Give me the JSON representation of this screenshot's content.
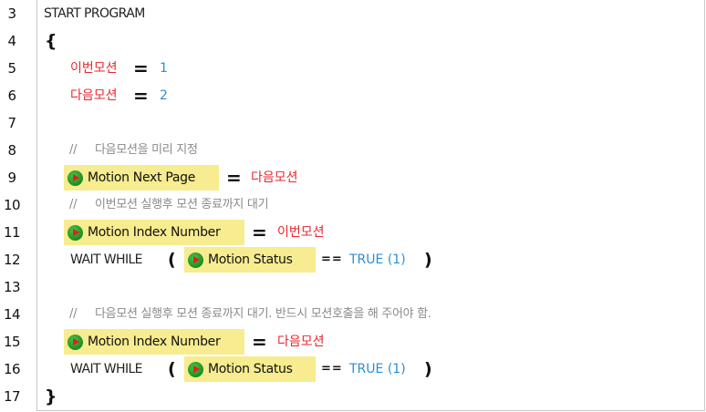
{
  "lines": {
    "l3": {
      "num": "3",
      "text": "START PROGRAM"
    },
    "l4": {
      "num": "4",
      "text": "{"
    },
    "l5": {
      "num": "5",
      "var": "이번모션",
      "eq": "=",
      "val": "1"
    },
    "l6": {
      "num": "6",
      "var": "다음모션",
      "eq": "=",
      "val": "2"
    },
    "l7": {
      "num": "7"
    },
    "l8": {
      "num": "8",
      "comment_mark": "//",
      "comment": "다음모션을 미리 지정"
    },
    "l9": {
      "num": "9",
      "func": "Motion Next Page",
      "eq": "=",
      "var": "다음모션"
    },
    "l10": {
      "num": "10",
      "comment_mark": "//",
      "comment": "이번모션 실행후 모션 종료까지 대기"
    },
    "l11": {
      "num": "11",
      "func": "Motion Index Number",
      "eq": "=",
      "var": "이번모션"
    },
    "l12": {
      "num": "12",
      "kw": "WAIT WHILE",
      "lparen": "(",
      "func": "Motion Status",
      "op": "==",
      "value": "TRUE (1)",
      "rparen": ")"
    },
    "l13": {
      "num": "13"
    },
    "l14": {
      "num": "14",
      "comment_mark": "//",
      "comment": "다음모션 실행후 모션 종료까지 대기. 반드시 모션호출을 해 주어야 함."
    },
    "l15": {
      "num": "15",
      "func": "Motion Index Number",
      "eq": "=",
      "var": "다음모션"
    },
    "l16": {
      "num": "16",
      "kw": "WAIT WHILE",
      "lparen": "(",
      "func": "Motion Status",
      "op": "==",
      "value": "TRUE (1)",
      "rparen": ")"
    },
    "l17": {
      "num": "17",
      "text": "}"
    }
  },
  "icons": {
    "function_block": "play-icon"
  },
  "colors": {
    "variable": "#e8272f",
    "number": "#2b8fd6",
    "comment": "#8a8a8a",
    "function_highlight": "#f7ec8f"
  }
}
